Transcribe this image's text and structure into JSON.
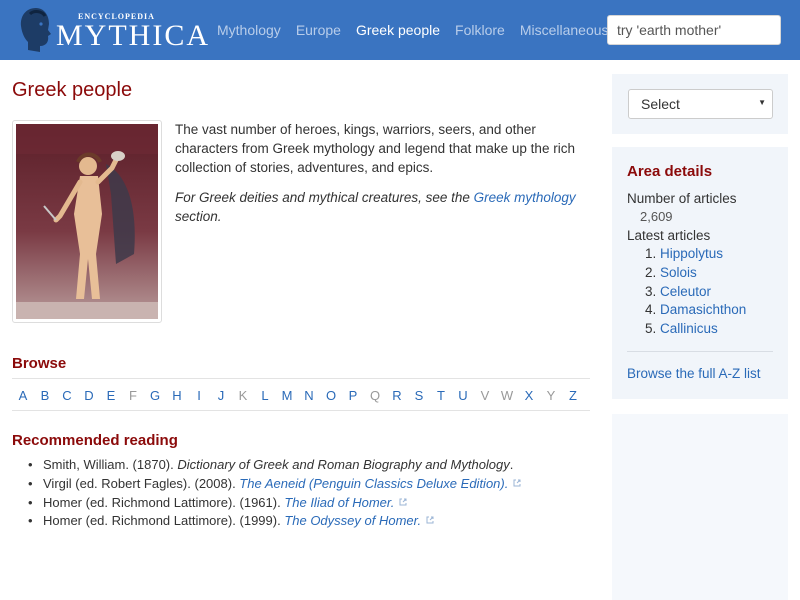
{
  "header": {
    "logo_small": "ENCYCLOPEDIA",
    "logo_big": "MYTHICA",
    "nav": [
      {
        "label": "Mythology",
        "active": false
      },
      {
        "label": "Europe",
        "active": false
      },
      {
        "label": "Greek people",
        "active": true
      },
      {
        "label": "Folklore",
        "active": false
      },
      {
        "label": "Miscellaneous",
        "active": false
      }
    ],
    "search_placeholder": "try 'earth mother'"
  },
  "main": {
    "title": "Greek people",
    "intro": "The vast number of heroes, kings, warriors, seers, and other characters from Greek mythology and legend that make up the rich collection of stories, adventures, and epics.",
    "note_before": "For Greek deities and mythical creatures, see the ",
    "note_link": "Greek mythology",
    "note_after": " section.",
    "browse_title": "Browse",
    "letters": [
      {
        "l": "A",
        "on": true
      },
      {
        "l": "B",
        "on": true
      },
      {
        "l": "C",
        "on": true
      },
      {
        "l": "D",
        "on": true
      },
      {
        "l": "E",
        "on": true
      },
      {
        "l": "F",
        "on": false
      },
      {
        "l": "G",
        "on": true
      },
      {
        "l": "H",
        "on": true
      },
      {
        "l": "I",
        "on": true
      },
      {
        "l": "J",
        "on": true
      },
      {
        "l": "K",
        "on": false
      },
      {
        "l": "L",
        "on": true
      },
      {
        "l": "M",
        "on": true
      },
      {
        "l": "N",
        "on": true
      },
      {
        "l": "O",
        "on": true
      },
      {
        "l": "P",
        "on": true
      },
      {
        "l": "Q",
        "on": false
      },
      {
        "l": "R",
        "on": true
      },
      {
        "l": "S",
        "on": true
      },
      {
        "l": "T",
        "on": true
      },
      {
        "l": "U",
        "on": true
      },
      {
        "l": "V",
        "on": false
      },
      {
        "l": "W",
        "on": false
      },
      {
        "l": "X",
        "on": true
      },
      {
        "l": "Y",
        "on": false
      },
      {
        "l": "Z",
        "on": true
      }
    ],
    "reading_title": "Recommended reading",
    "reading": [
      {
        "author": "Smith, William. (1870). ",
        "title": "Dictionary of Greek and Roman Biography and Mythology",
        "end": ".",
        "link": false
      },
      {
        "author": "Virgil (ed. Robert Fagles). (2008). ",
        "title": "The Aeneid (Penguin Classics Deluxe Edition)",
        "end": ".",
        "link": true
      },
      {
        "author": "Homer (ed. Richmond Lattimore). (1961). ",
        "title": "The Iliad of Homer",
        "end": ".",
        "link": true
      },
      {
        "author": "Homer (ed. Richmond Lattimore). (1999). ",
        "title": "The Odyssey of Homer",
        "end": ".",
        "link": true
      }
    ]
  },
  "sidebar": {
    "select_label": "Select",
    "area_title": "Area details",
    "articles_label": "Number of articles",
    "articles_count": "2,609",
    "latest_label": "Latest articles",
    "latest": [
      "Hippolytus",
      "Solois",
      "Celeutor",
      "Damasichthon",
      "Callinicus"
    ],
    "az_link": "Browse the full A-Z list"
  },
  "colors": {
    "header_bg": "#3a74c1",
    "heading_red": "#8b0a0a",
    "link_blue": "#2a6ab8",
    "sidebar_bg": "#f1f5fa"
  }
}
